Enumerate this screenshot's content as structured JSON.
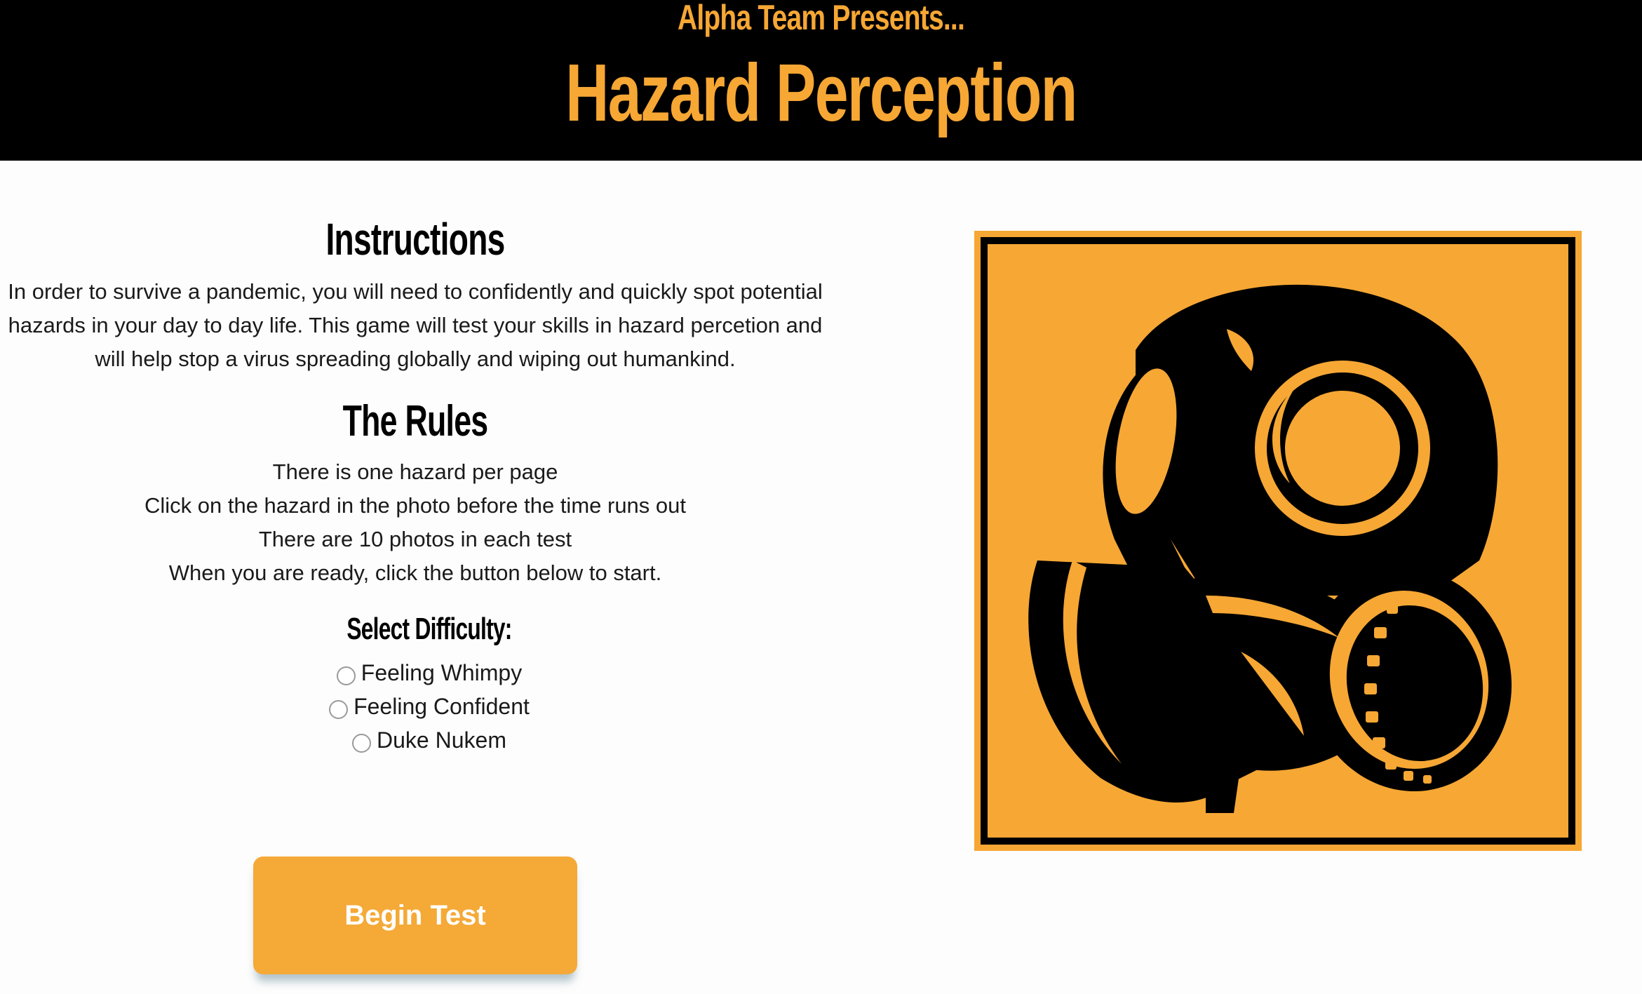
{
  "header": {
    "presents": "Alpha Team Presents...",
    "title": "Hazard Perception"
  },
  "instructions": {
    "heading": "Instructions",
    "lines": [
      "In order to survive a pandemic, you will need to confidently and quickly spot potential",
      "hazards in your day to day life. This game will test your skills in hazard percetion and",
      "will help stop a virus spreading globally and wiping out humankind."
    ]
  },
  "rules": {
    "heading": "The Rules",
    "items": [
      "There is one hazard per page",
      "Click on the hazard in the photo before the time runs out",
      "There are 10 photos in each test",
      "When you are ready, click the button below to start."
    ]
  },
  "difficulty": {
    "heading": "Select Difficulty:",
    "options": [
      "Feeling Whimpy",
      "Feeling Confident",
      "Duke Nukem"
    ]
  },
  "begin_button_label": "Begin Test",
  "hazard_icon": "gas-mask-icon",
  "colors": {
    "accent": "#f6a734",
    "header_bg": "#000000",
    "button_bg": "#f5a937",
    "text": "#1a1a1a"
  }
}
